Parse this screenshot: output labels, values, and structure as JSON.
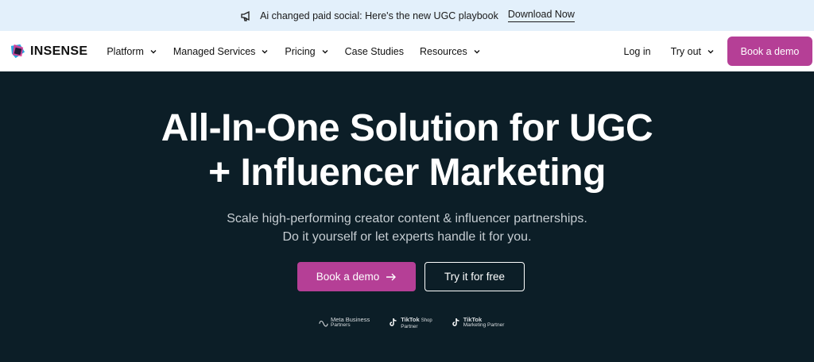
{
  "announcement": {
    "icon": "megaphone-icon",
    "message": "Ai changed paid social: Here's the new UGC playbook",
    "cta": "Download Now"
  },
  "nav": {
    "logo_text": "INSENSE",
    "menu": [
      {
        "label": "Platform",
        "dropdown": true
      },
      {
        "label": "Managed Services",
        "dropdown": true
      },
      {
        "label": "Pricing",
        "dropdown": true
      },
      {
        "label": "Case Studies",
        "dropdown": false
      },
      {
        "label": "Resources",
        "dropdown": true
      }
    ],
    "login": "Log in",
    "try_out": "Try out",
    "book_demo": "Book a demo"
  },
  "hero": {
    "headline_line1": "All-In-One Solution for UGC",
    "headline_line2": "+ Influencer Marketing",
    "sub_line1": "Scale high-performing creator content & influencer partnerships.",
    "sub_line2": "Do it yourself or let experts handle it for you.",
    "primary_cta": "Book a demo",
    "primary_cta_icon": "arrow-right-icon",
    "secondary_cta": "Try it for free"
  },
  "partners": [
    {
      "icon": "meta-icon",
      "line1": "Meta Business",
      "line2": "Partners"
    },
    {
      "icon": "tiktok-icon",
      "line1": "TikTok",
      "line1b": "Shop",
      "line2": "Partner"
    },
    {
      "icon": "tiktok-icon",
      "line1": "TikTok",
      "line2": "Marketing Partner"
    }
  ],
  "colors": {
    "accent": "#b53f96",
    "hero_bg": "#0c1e27",
    "announce_bg": "#e3f0fb"
  }
}
